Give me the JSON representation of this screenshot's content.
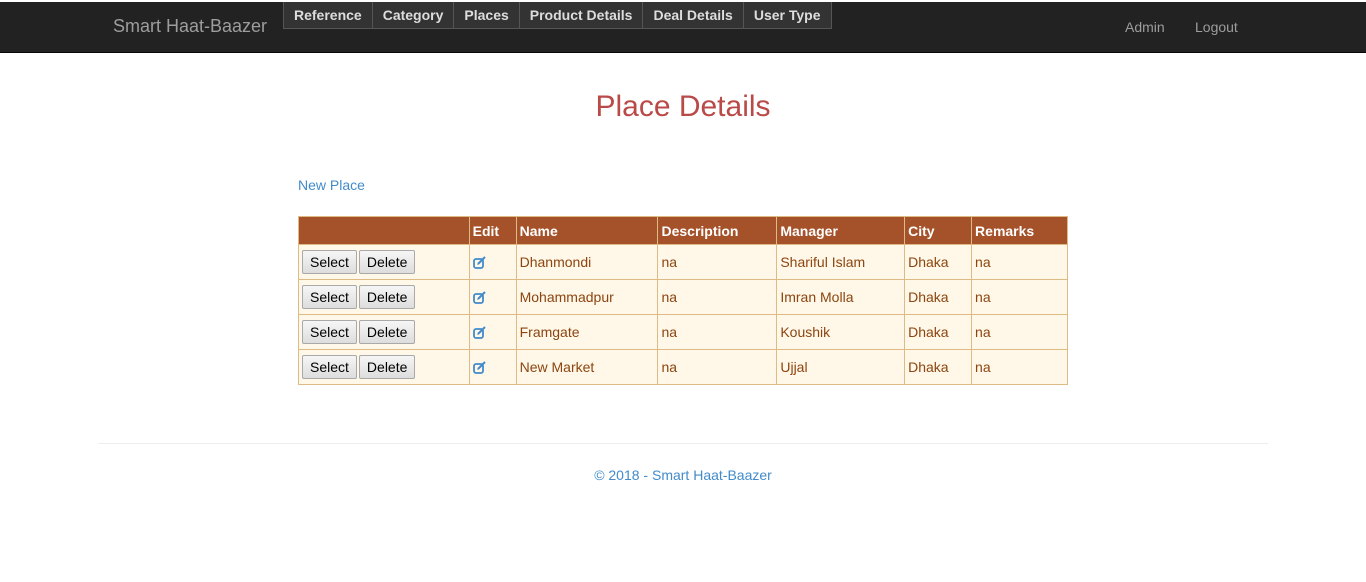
{
  "navbar": {
    "brand": "Smart Haat-Baazer",
    "menu": [
      "Reference",
      "Category",
      "Places",
      "Product Details",
      "Deal Details",
      "User Type"
    ],
    "admin": "Admin",
    "logout": "Logout"
  },
  "page": {
    "title": "Place Details",
    "new_link": "New Place"
  },
  "table": {
    "headers": [
      "",
      "Edit",
      "Name",
      "Description",
      "Manager",
      "City",
      "Remarks"
    ],
    "select_label": "Select",
    "delete_label": "Delete",
    "rows": [
      {
        "name": "Dhanmondi",
        "description": "na",
        "manager": "Shariful Islam",
        "city": "Dhaka",
        "remarks": "na"
      },
      {
        "name": "Mohammadpur",
        "description": "na",
        "manager": "Imran Molla",
        "city": "Dhaka",
        "remarks": "na"
      },
      {
        "name": "Framgate",
        "description": "na",
        "manager": "Koushik",
        "city": "Dhaka",
        "remarks": "na"
      },
      {
        "name": "New Market",
        "description": "na",
        "manager": "Ujjal",
        "city": "Dhaka",
        "remarks": "na"
      }
    ]
  },
  "footer": {
    "text": "© 2018 - Smart Haat-Baazer"
  },
  "colors": {
    "navbar_bg": "#222222",
    "title": "#b94a48",
    "header_bg": "#a55129",
    "row_bg": "#fff7e7",
    "link": "#428bca"
  }
}
